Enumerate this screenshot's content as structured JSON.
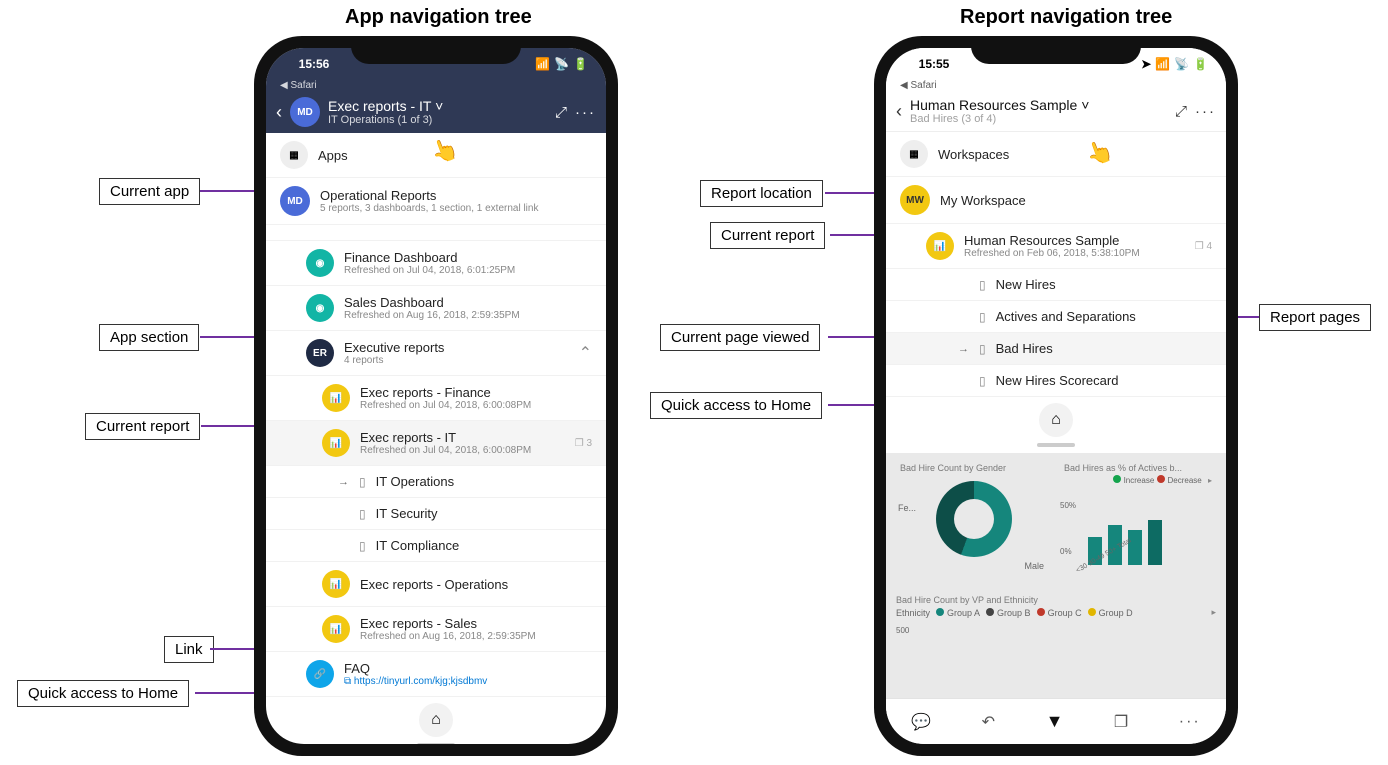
{
  "titles": {
    "left": "App navigation tree",
    "right": "Report navigation tree"
  },
  "callouts": {
    "current_app": "Current app",
    "app_section": "App section",
    "current_report_left": "Current report",
    "link": "Link",
    "quick_home_left": "Quick access to Home",
    "report_location": "Report location",
    "current_report_right": "Current report",
    "current_page": "Current page viewed",
    "quick_home_right": "Quick access to Home",
    "report_pages": "Report pages"
  },
  "left_phone": {
    "time": "15:56",
    "safari": "Safari",
    "header": {
      "avatar": "MD",
      "title": "Exec reports - IT",
      "subtitle": "IT Operations (1 of 3)"
    },
    "apps_label": "Apps",
    "current_app": {
      "avatar": "MD",
      "title": "Operational Reports",
      "sub": "5 reports, 3 dashboards, 1 section, 1 external link"
    },
    "dash1": {
      "title": "Finance Dashboard",
      "sub": "Refreshed on Jul 04, 2018, 6:01:25PM"
    },
    "dash2": {
      "title": "Sales Dashboard",
      "sub": "Refreshed on Aug 16, 2018, 2:59:35PM"
    },
    "section": {
      "avatar": "ER",
      "title": "Executive reports",
      "sub": "4 reports"
    },
    "rep1": {
      "title": "Exec reports - Finance",
      "sub": "Refreshed on Jul 04, 2018, 6:00:08PM"
    },
    "rep2": {
      "title": "Exec reports - IT",
      "sub": "Refreshed on Jul 04, 2018, 6:00:08PM",
      "badge": "3"
    },
    "pages": [
      "IT Operations",
      "IT Security",
      "IT Compliance"
    ],
    "rep3": {
      "title": "Exec reports - Operations"
    },
    "rep4": {
      "title": "Exec reports - Sales",
      "sub": "Refreshed on Aug 16, 2018, 2:59:35PM"
    },
    "faq": {
      "title": "FAQ",
      "url": "https://tinyurl.com/kjg;kjsdbmv"
    }
  },
  "right_phone": {
    "time": "15:55",
    "safari": "Safari",
    "header": {
      "title": "Human Resources Sample",
      "subtitle": "Bad Hires (3 of 4)"
    },
    "workspaces_label": "Workspaces",
    "myworkspace": {
      "avatar": "MW",
      "title": "My Workspace"
    },
    "report": {
      "title": "Human Resources Sample",
      "sub": "Refreshed on Feb 06, 2018, 5:38:10PM",
      "badge": "4"
    },
    "pages": [
      "New Hires",
      "Actives and Separations",
      "Bad Hires",
      "New Hires Scorecard"
    ],
    "charts": {
      "c1_title": "Bad Hire Count by Gender",
      "c1_labels": [
        "Fe...",
        "Male"
      ],
      "c2_title": "Bad Hires as % of Actives b...",
      "legend": [
        "Increase",
        "Decrease"
      ],
      "c2_axis": [
        "50%",
        "0%"
      ],
      "c2_cats": [
        "<30",
        "30-49",
        "50+",
        "Total"
      ],
      "c3_title": "Bad Hire Count by VP and Ethnicity",
      "eth_label": "Ethnicity",
      "eth_groups": [
        "Group A",
        "Group B",
        "Group C",
        "Group D"
      ],
      "y500": "500"
    }
  },
  "chart_data": [
    {
      "type": "pie",
      "title": "Bad Hire Count by Gender",
      "categories": [
        "Female",
        "Male"
      ],
      "values": [
        56,
        44
      ]
    },
    {
      "type": "bar",
      "title": "Bad Hires as % of Actives",
      "categories": [
        "<30",
        "30-49",
        "50+",
        "Total"
      ],
      "values": [
        28,
        40,
        35,
        45
      ],
      "ylim": [
        0,
        50
      ],
      "ylabel": "%"
    }
  ]
}
